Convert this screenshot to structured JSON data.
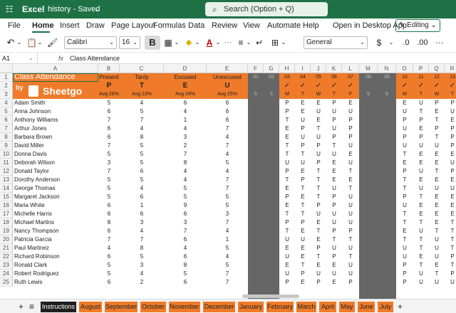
{
  "titlebar": {
    "waffle": "☷",
    "app": "Excel",
    "doc": "history",
    "status": "Saved",
    "chevron": "⌄"
  },
  "search": {
    "placeholder": "Search (Option + Q)"
  },
  "menu": [
    "File",
    "Home",
    "Insert",
    "Draw",
    "Page Layout",
    "Formulas",
    "Data",
    "Review",
    "View",
    "Automate",
    "Help"
  ],
  "menu_active": "Home",
  "open_desktop": "Open in Desktop App",
  "editing": "Editing",
  "ribbon": {
    "font": "Calibri",
    "size": "16",
    "numfmt": "General",
    "bold": "B"
  },
  "namebox": "A1",
  "fx": "fx",
  "formula": "Class Attendance",
  "columns": [
    "A",
    "B",
    "C",
    "D",
    "E",
    "F",
    "G",
    "H",
    "I",
    "J",
    "K",
    "L",
    "M",
    "N",
    "O",
    "P",
    "Q",
    "R"
  ],
  "header": {
    "title": "Class Attendance",
    "by": "by",
    "brand": "Sheetgo",
    "stats": [
      {
        "name": "Present",
        "code": "P",
        "avg": "Avg 26%"
      },
      {
        "name": "Tardy",
        "code": "T",
        "avg": "Avg 23%"
      },
      {
        "name": "Excused",
        "code": "E",
        "avg": "Avg 24%"
      },
      {
        "name": "Unexcused",
        "code": "U",
        "avg": "Avg 25%"
      }
    ],
    "days": [
      {
        "col": "F",
        "day": "01",
        "wk": "",
        "n": "5",
        "dark": true
      },
      {
        "col": "G",
        "day": "02",
        "wk": "",
        "n": "5",
        "dark": true
      },
      {
        "col": "H",
        "day": "03",
        "wk": "M",
        "n": "",
        "dark": false
      },
      {
        "col": "I",
        "day": "04",
        "wk": "T",
        "n": "",
        "dark": false
      },
      {
        "col": "J",
        "day": "05",
        "wk": "W",
        "n": "",
        "dark": false
      },
      {
        "col": "K",
        "day": "06",
        "wk": "T",
        "n": "",
        "dark": false
      },
      {
        "col": "L",
        "day": "07",
        "wk": "F",
        "n": "",
        "dark": false
      },
      {
        "col": "M",
        "day": "08",
        "wk": "",
        "n": "5",
        "dark": true
      },
      {
        "col": "N",
        "day": "09",
        "wk": "",
        "n": "5",
        "dark": true
      },
      {
        "col": "O",
        "day": "10",
        "wk": "M",
        "n": "",
        "dark": false
      },
      {
        "col": "P",
        "day": "11",
        "wk": "T",
        "n": "",
        "dark": false
      },
      {
        "col": "Q",
        "day": "12",
        "wk": "W",
        "n": "",
        "dark": false
      },
      {
        "col": "R",
        "day": "13",
        "wk": "T",
        "n": "",
        "dark": false
      }
    ],
    "check": "✓"
  },
  "students": [
    {
      "row": "4",
      "name": "Adam Smith",
      "p": "5",
      "t": "4",
      "e": "6",
      "u": "6",
      "days": [
        "P",
        "E",
        "E",
        "P",
        "E"
      ],
      "days2": [
        "E",
        "U",
        "P",
        "P"
      ]
    },
    {
      "row": "5",
      "name": "Anna Johnson",
      "p": "6",
      "t": "5",
      "e": "4",
      "u": "6",
      "days": [
        "P",
        "E",
        "U",
        "U",
        "U"
      ],
      "days2": [
        "U",
        "T",
        "E",
        "U"
      ]
    },
    {
      "row": "6",
      "name": "Anthony Williams",
      "p": "7",
      "t": "7",
      "e": "1",
      "u": "6",
      "days": [
        "T",
        "U",
        "E",
        "P",
        "P"
      ],
      "days2": [
        "P",
        "P",
        "T",
        "E"
      ]
    },
    {
      "row": "7",
      "name": "Arthur Jones",
      "p": "6",
      "t": "4",
      "e": "4",
      "u": "7",
      "days": [
        "E",
        "P",
        "T",
        "U",
        "P"
      ],
      "days2": [
        "U",
        "E",
        "P",
        "P"
      ]
    },
    {
      "row": "8",
      "name": "Barbara Brown",
      "p": "6",
      "t": "8",
      "e": "3",
      "u": "4",
      "days": [
        "E",
        "U",
        "U",
        "P",
        "P"
      ],
      "days2": [
        "P",
        "P",
        "T",
        "P"
      ]
    },
    {
      "row": "9",
      "name": "David Miller",
      "p": "7",
      "t": "5",
      "e": "2",
      "u": "7",
      "days": [
        "T",
        "P",
        "P",
        "T",
        "U"
      ],
      "days2": [
        "U",
        "U",
        "U",
        "P"
      ]
    },
    {
      "row": "10",
      "name": "Donna Davis",
      "p": "5",
      "t": "5",
      "e": "7",
      "u": "4",
      "days": [
        "T",
        "T",
        "U",
        "U",
        "E"
      ],
      "days2": [
        "T",
        "E",
        "E",
        "E"
      ]
    },
    {
      "row": "11",
      "name": "Deborah Wilson",
      "p": "3",
      "t": "5",
      "e": "8",
      "u": "5",
      "days": [
        "U",
        "U",
        "P",
        "E",
        "U"
      ],
      "days2": [
        "E",
        "E",
        "E",
        "U"
      ]
    },
    {
      "row": "12",
      "name": "Donald Taylor",
      "p": "7",
      "t": "6",
      "e": "4",
      "u": "4",
      "days": [
        "P",
        "E",
        "T",
        "E",
        "T"
      ],
      "days2": [
        "P",
        "U",
        "T",
        "P"
      ]
    },
    {
      "row": "13",
      "name": "Dorothy Anderson",
      "p": "5",
      "t": "5",
      "e": "4",
      "u": "7",
      "days": [
        "T",
        "P",
        "T",
        "E",
        "E"
      ],
      "days2": [
        "T",
        "E",
        "E",
        "E"
      ]
    },
    {
      "row": "14",
      "name": "George Thomas",
      "p": "5",
      "t": "4",
      "e": "5",
      "u": "7",
      "days": [
        "E",
        "T",
        "T",
        "U",
        "T"
      ],
      "days2": [
        "T",
        "U",
        "U",
        "U"
      ]
    },
    {
      "row": "15",
      "name": "Margaret Jackson",
      "p": "5",
      "t": "6",
      "e": "5",
      "u": "5",
      "days": [
        "P",
        "E",
        "T",
        "P",
        "U"
      ],
      "days2": [
        "P",
        "T",
        "E",
        "E"
      ]
    },
    {
      "row": "16",
      "name": "Maria White",
      "p": "6",
      "t": "1",
      "e": "9",
      "u": "5",
      "days": [
        "E",
        "T",
        "P",
        "P",
        "U"
      ],
      "days2": [
        "U",
        "E",
        "E",
        "E"
      ]
    },
    {
      "row": "17",
      "name": "Michelle Harris",
      "p": "6",
      "t": "6",
      "e": "6",
      "u": "3",
      "days": [
        "T",
        "T",
        "U",
        "U",
        "U"
      ],
      "days2": [
        "T",
        "E",
        "E",
        "E"
      ]
    },
    {
      "row": "18",
      "name": "Michael Martins",
      "p": "8",
      "t": "3",
      "e": "3",
      "u": "7",
      "days": [
        "P",
        "P",
        "E",
        "U",
        "U"
      ],
      "days2": [
        "T",
        "T",
        "E",
        "T"
      ]
    },
    {
      "row": "19",
      "name": "Nancy Thompson",
      "p": "6",
      "t": "4",
      "e": "7",
      "u": "4",
      "days": [
        "T",
        "E",
        "T",
        "P",
        "P"
      ],
      "days2": [
        "E",
        "U",
        "T",
        "T"
      ]
    },
    {
      "row": "20",
      "name": "Patricia Garcia",
      "p": "7",
      "t": "7",
      "e": "6",
      "u": "1",
      "days": [
        "U",
        "U",
        "E",
        "T",
        "T"
      ],
      "days2": [
        "T",
        "T",
        "U",
        "T"
      ]
    },
    {
      "row": "21",
      "name": "Paul Martinez",
      "p": "4",
      "t": "8",
      "e": "4",
      "u": "5",
      "days": [
        "E",
        "E",
        "P",
        "U",
        "U"
      ],
      "days2": [
        "U",
        "T",
        "U",
        "T"
      ]
    },
    {
      "row": "22",
      "name": "Richard Robinson",
      "p": "6",
      "t": "5",
      "e": "6",
      "u": "4",
      "days": [
        "U",
        "E",
        "T",
        "P",
        "T"
      ],
      "days2": [
        "U",
        "E",
        "U",
        "P"
      ]
    },
    {
      "row": "23",
      "name": "Ronald Clark",
      "p": "5",
      "t": "3",
      "e": "8",
      "u": "5",
      "days": [
        "E",
        "T",
        "E",
        "E",
        "U"
      ],
      "days2": [
        "P",
        "T",
        "E",
        "T"
      ]
    },
    {
      "row": "24",
      "name": "Robert Rodriguez",
      "p": "5",
      "t": "4",
      "e": "5",
      "u": "7",
      "days": [
        "U",
        "P",
        "U",
        "U",
        "U"
      ],
      "days2": [
        "P",
        "U",
        "T",
        "P"
      ]
    },
    {
      "row": "25",
      "name": "Ruth Lewis",
      "p": "6",
      "t": "2",
      "e": "6",
      "u": "7",
      "days": [
        "P",
        "E",
        "P",
        "E",
        "P"
      ],
      "days2": [
        "P",
        "U",
        "U",
        "U"
      ]
    }
  ],
  "tabs": [
    "Instructions",
    "August",
    "September",
    "October",
    "November",
    "December",
    "January",
    "February",
    "March",
    "April",
    "May",
    "June",
    "July"
  ],
  "active_tab": "Instructions",
  "colors": {
    "excel_green": "#1e7145",
    "orange": "#ef7b2a",
    "dark_col": "#666666"
  },
  "icons": [
    "waffle-icon",
    "search-icon",
    "undo-icon",
    "paste-icon",
    "bold-icon",
    "fill-color-icon",
    "font-color-icon",
    "borders-icon",
    "check-icon",
    "plus-icon",
    "menu-icon"
  ]
}
